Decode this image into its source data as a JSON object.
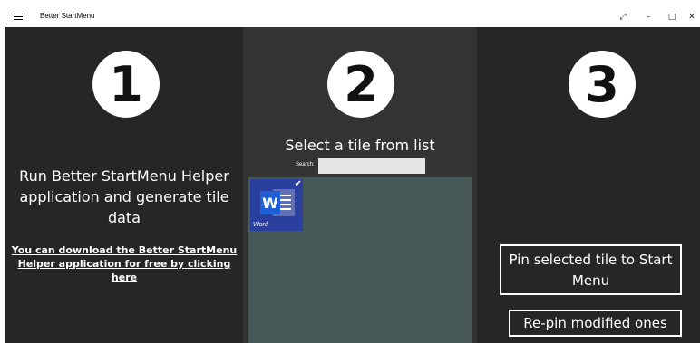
{
  "window": {
    "title": "Better StartMenu",
    "menu_icon": "hamburger-icon",
    "controls": [
      {
        "name": "expand-icon",
        "glyph": "⤢"
      },
      {
        "name": "minimize-icon",
        "glyph": "–"
      },
      {
        "name": "maximize-icon",
        "glyph": "□"
      },
      {
        "name": "close-icon",
        "glyph": "✕"
      }
    ]
  },
  "step1": {
    "number": "1",
    "description": "Run Better StartMenu Helper application and generate tile data",
    "link_text_line1": "You can download the Better StartMenu",
    "link_text_line2": "Helper application for free by clicking here"
  },
  "step2": {
    "number": "2",
    "heading": "Select a tile from list",
    "search_label": "Search:",
    "search_value": "",
    "tiles": [
      {
        "label": "Word",
        "icon": "word-icon",
        "selected": true,
        "color": "#2b3f9e"
      }
    ]
  },
  "step3": {
    "number": "3",
    "pin_button": "Pin selected tile to Start Menu",
    "repin_button": "Re-pin modified ones"
  },
  "colors": {
    "background": "#262626",
    "middle_panel": "#333333",
    "tile_list": "#465757",
    "accent_tile": "#2b3f9e"
  }
}
